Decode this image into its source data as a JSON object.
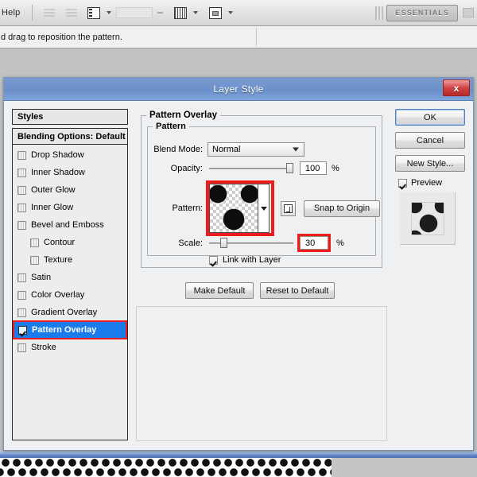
{
  "app": {
    "menu_label": "Help",
    "workspace_button": "ESSENTIALS",
    "status_text": "d drag to reposition the pattern."
  },
  "dialog": {
    "title": "Layer Style",
    "close_label": "x"
  },
  "styles_panel": {
    "header": "Styles",
    "blending_options": "Blending Options: Default",
    "effects": [
      {
        "label": "Drop Shadow",
        "checked": false,
        "sub": false,
        "selected": false
      },
      {
        "label": "Inner Shadow",
        "checked": false,
        "sub": false,
        "selected": false
      },
      {
        "label": "Outer Glow",
        "checked": false,
        "sub": false,
        "selected": false
      },
      {
        "label": "Inner Glow",
        "checked": false,
        "sub": false,
        "selected": false
      },
      {
        "label": "Bevel and Emboss",
        "checked": false,
        "sub": false,
        "selected": false
      },
      {
        "label": "Contour",
        "checked": false,
        "sub": true,
        "selected": false
      },
      {
        "label": "Texture",
        "checked": false,
        "sub": true,
        "selected": false
      },
      {
        "label": "Satin",
        "checked": false,
        "sub": false,
        "selected": false
      },
      {
        "label": "Color Overlay",
        "checked": false,
        "sub": false,
        "selected": false
      },
      {
        "label": "Gradient Overlay",
        "checked": false,
        "sub": false,
        "selected": false
      },
      {
        "label": "Pattern Overlay",
        "checked": true,
        "sub": false,
        "selected": true
      },
      {
        "label": "Stroke",
        "checked": false,
        "sub": false,
        "selected": false
      }
    ]
  },
  "pattern_overlay": {
    "section_title": "Pattern Overlay",
    "group_title": "Pattern",
    "blend_mode_label": "Blend Mode:",
    "blend_mode_value": "Normal",
    "opacity_label": "Opacity:",
    "opacity_value": "100",
    "opacity_unit": "%",
    "pattern_label": "Pattern:",
    "snap_to_origin_label": "Snap to Origin",
    "scale_label": "Scale:",
    "scale_value": "30",
    "scale_unit": "%",
    "link_with_layer_label": "Link with Layer",
    "link_with_layer_checked": true,
    "make_default_label": "Make Default",
    "reset_to_default_label": "Reset to Default"
  },
  "actions": {
    "ok_label": "OK",
    "cancel_label": "Cancel",
    "new_style_label": "New Style...",
    "preview_label": "Preview",
    "preview_checked": true
  },
  "colors": {
    "titlebar_blue": "#6f92cb",
    "selection_blue": "#1a7bea",
    "highlight_red": "#ee1c1c",
    "close_red": "#d04343"
  }
}
